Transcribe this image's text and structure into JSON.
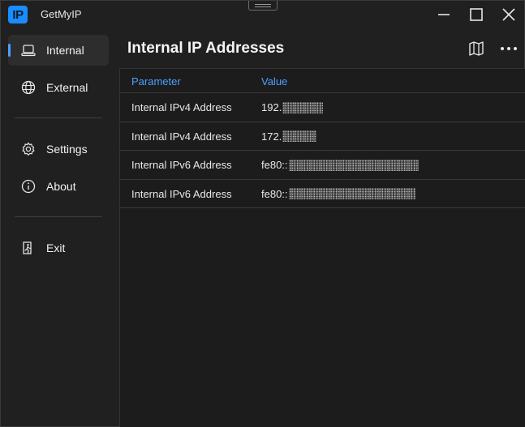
{
  "app": {
    "icon_text": "IP",
    "title": "GetMyIP"
  },
  "sidebar": {
    "items": [
      {
        "label": "Internal",
        "icon": "laptop-icon",
        "active": true
      },
      {
        "label": "External",
        "icon": "globe-icon",
        "active": false
      },
      {
        "label": "Settings",
        "icon": "gear-icon",
        "active": false
      },
      {
        "label": "About",
        "icon": "info-icon",
        "active": false
      },
      {
        "label": "Exit",
        "icon": "exit-icon",
        "active": false
      }
    ]
  },
  "main": {
    "title": "Internal IP Addresses",
    "actions": [
      {
        "icon": "map-icon"
      },
      {
        "icon": "more-icon"
      }
    ],
    "table": {
      "headers": {
        "parameter": "Parameter",
        "value": "Value"
      },
      "rows": [
        {
          "parameter": "Internal IPv4 Address",
          "value_prefix": "192."
        },
        {
          "parameter": "Internal IPv4 Address",
          "value_prefix": "172."
        },
        {
          "parameter": "Internal IPv6 Address",
          "value_prefix": "fe80::"
        },
        {
          "parameter": "Internal IPv6 Address",
          "value_prefix": "fe80::"
        }
      ]
    }
  },
  "colors": {
    "accent": "#4ca0ff",
    "app_icon": "#1a8cff",
    "background": "#202020",
    "panel": "#1c1c1c"
  }
}
